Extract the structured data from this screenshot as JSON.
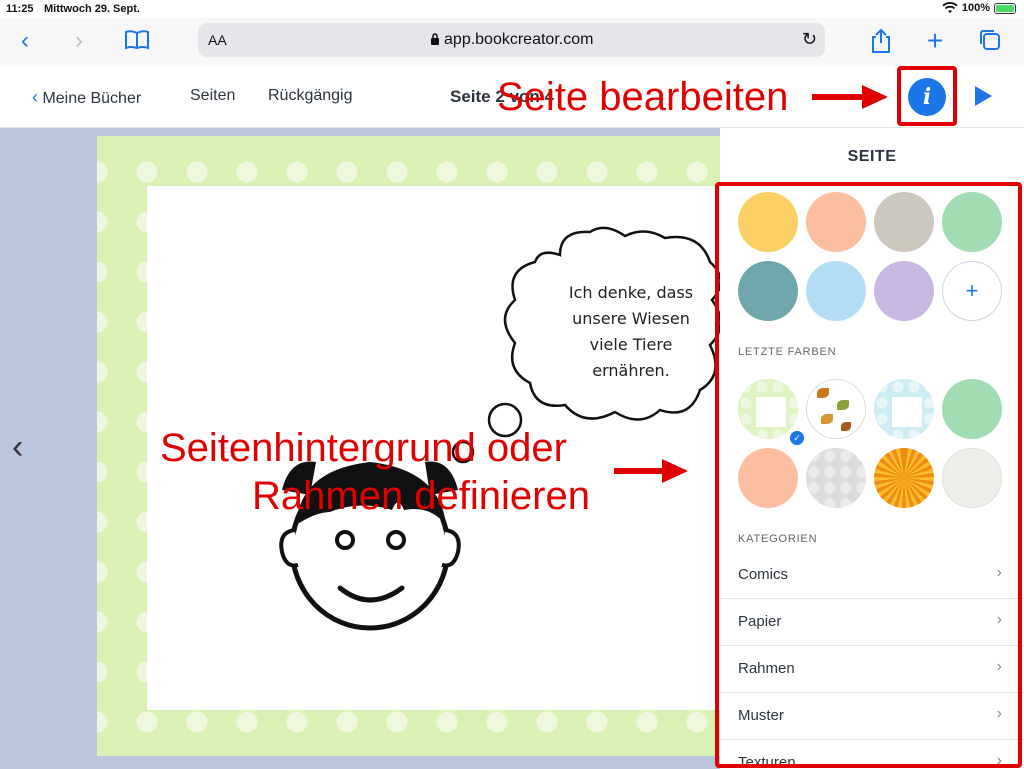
{
  "status": {
    "time": "11:25",
    "date": "Mittwoch 29. Sept.",
    "battery": "100%"
  },
  "browser": {
    "aa": "AA",
    "url": "app.bookcreator.com",
    "icons": [
      "back-chevron",
      "forward-chevron",
      "bookmarks-book",
      "lock",
      "reload",
      "share",
      "plus",
      "tabs"
    ]
  },
  "appbar": {
    "back": "Meine Bücher",
    "pages": "Seiten",
    "undo": "Rückgängig",
    "title": "Seite 2 von 4",
    "info": "i"
  },
  "canvas": {
    "thought": "Ich denke, dass unsere Wiesen viele Tiere ernähren."
  },
  "panel": {
    "title": "SEITE",
    "colors": [
      "#fdd066",
      "#fdbea0",
      "#ccc7bf",
      "#a1dcb3",
      "#70a7ab",
      "#b3dcf5",
      "#c8b8e1"
    ],
    "add": "+",
    "recent_label": "LETZTE FARBEN",
    "categories_label": "KATEGORIEN",
    "categories": [
      "Comics",
      "Papier",
      "Rahmen",
      "Muster",
      "Texturen"
    ]
  },
  "annotations": {
    "edit_page": "Seite bearbeiten",
    "background_line1": "Seitenhintergrund  oder",
    "background_line2": "Rahmen definieren"
  }
}
